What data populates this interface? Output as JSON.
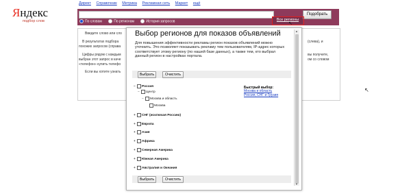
{
  "header": {
    "logo_text_y": "Я",
    "logo_text_rest": "ндекс",
    "logo_sub": "подбор слов",
    "nav": [
      "Директ",
      "Справочник",
      "Метрика",
      "Рекламная сеть",
      "Маркет",
      "ещё"
    ],
    "pick_button": "Подобрать",
    "radios": [
      {
        "label": "По словам",
        "checked": true
      },
      {
        "label": "По регионам",
        "checked": false
      },
      {
        "label": "История запросов",
        "checked": false
      }
    ],
    "regions_link": "Все регионы"
  },
  "background_page": {
    "lines_left": [
      "Введите слово или сло",
      "В результатах подбора",
      "похожих запросов (справа",
      "Цифры рядом с каждым",
      "выбран этот запрос в каче",
      "«телефон» купить телефо",
      "Если вы хотите узнать"
    ],
    "lines_right": [
      "(слева), и",
      "вы получите,",
      "ом со словом"
    ]
  },
  "modal": {
    "title": "Выбор регионов для показов объявлений",
    "description": "Для повышения эффективности рекламы регион показов объявлений можно уточнить. Это позволяет показывать рекламу тем пользователям, IP-адрес которых соответствует этому региону (по нашей базе данных), а также тем, кто выбрал данный регион в настройках портала.",
    "select_button": "Выбрать",
    "clear_button": "Очистить",
    "tree": [
      {
        "label": "Россия",
        "bold": true,
        "pm": "−"
      },
      {
        "label": "Центр",
        "bold": false,
        "pm": "−"
      },
      {
        "label": "Москва и область",
        "bold": false,
        "pm": "−"
      },
      {
        "label": "Москва",
        "bold": false,
        "pm": ""
      },
      {
        "label": "СНГ (исключая Россию)",
        "bold": true,
        "pm": "+"
      },
      {
        "label": "Европа",
        "bold": true,
        "pm": "+"
      },
      {
        "label": "Азия",
        "bold": true,
        "pm": "+"
      },
      {
        "label": "Африка",
        "bold": true,
        "pm": "+"
      },
      {
        "label": "Северная Америка",
        "bold": true,
        "pm": "+"
      },
      {
        "label": "Южная Америка",
        "bold": true,
        "pm": "+"
      },
      {
        "label": "Австралия и Океания",
        "bold": true,
        "pm": "+"
      }
    ],
    "quick": {
      "heading": "Быстрый выбор:",
      "links": [
        "Москва и область",
        "Россия, СНГ и Грузия"
      ]
    }
  }
}
